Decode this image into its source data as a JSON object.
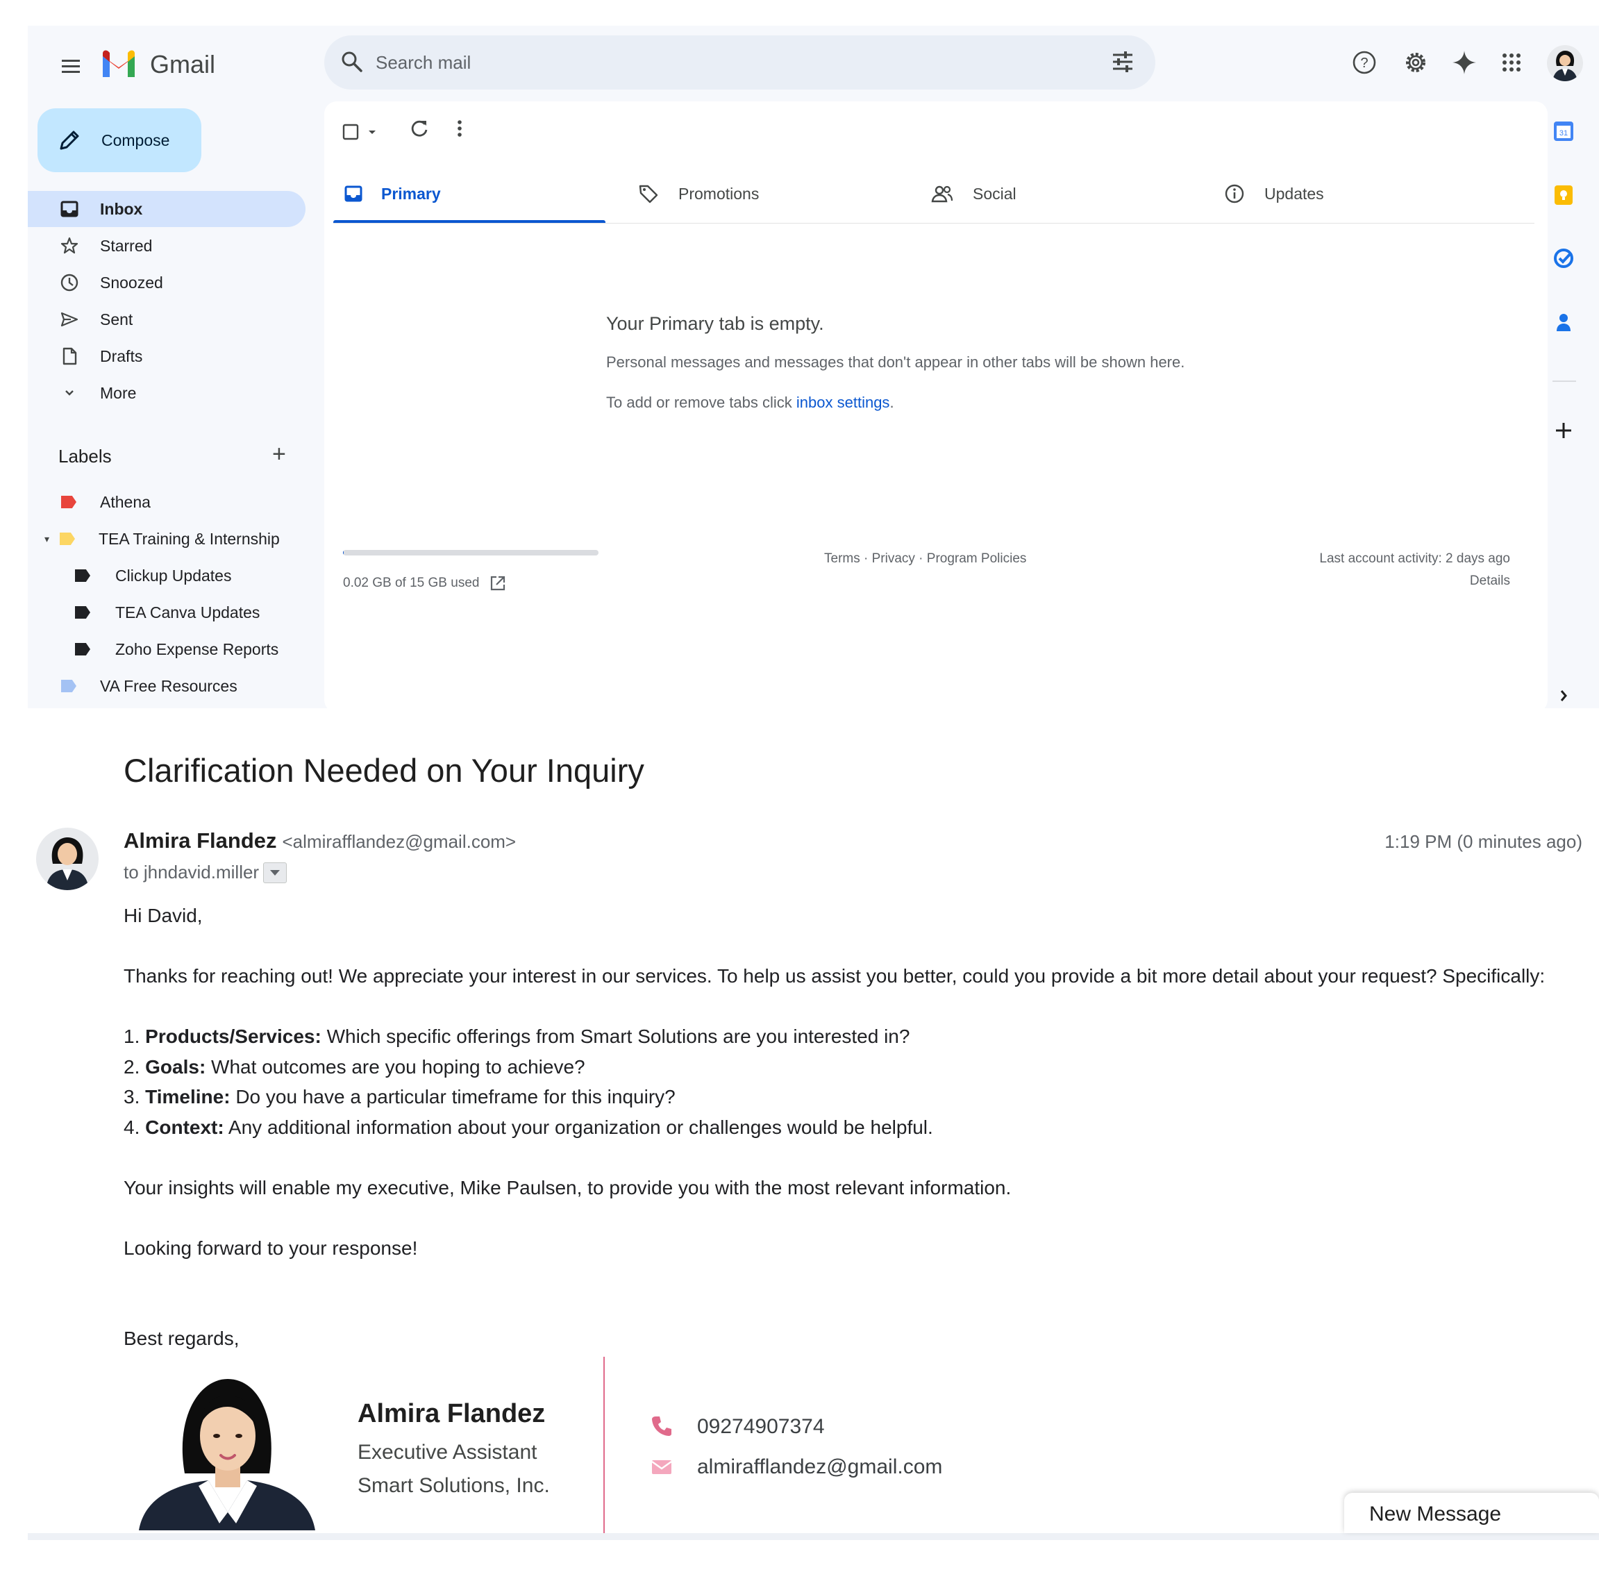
{
  "app": {
    "name": "Gmail",
    "search_placeholder": "Search mail"
  },
  "sidebar": {
    "compose_label": "Compose",
    "nav": [
      {
        "label": "Inbox",
        "icon": "inbox-icon",
        "active": true
      },
      {
        "label": "Starred",
        "icon": "star-icon"
      },
      {
        "label": "Snoozed",
        "icon": "clock-icon"
      },
      {
        "label": "Sent",
        "icon": "send-icon"
      },
      {
        "label": "Drafts",
        "icon": "draft-icon"
      },
      {
        "label": "More",
        "icon": "chevron-down-icon"
      }
    ],
    "labels_heading": "Labels",
    "labels": [
      {
        "label": "Athena",
        "color": "#e8453c"
      },
      {
        "label": "TEA Training & Internship",
        "color": "#fcd663"
      },
      {
        "label": "Clickup Updates",
        "color": "#202124"
      },
      {
        "label": "TEA Canva Updates",
        "color": "#202124"
      },
      {
        "label": "Zoho Expense Reports",
        "color": "#202124"
      },
      {
        "label": "VA Free Resources",
        "color": "#a4c2f4"
      }
    ]
  },
  "tabs": [
    {
      "label": "Primary",
      "icon": "inbox-tab-icon"
    },
    {
      "label": "Promotions",
      "icon": "tag-icon"
    },
    {
      "label": "Social",
      "icon": "people-icon"
    },
    {
      "label": "Updates",
      "icon": "info-icon"
    }
  ],
  "empty_state": {
    "title": "Your Primary tab is empty.",
    "description": "Personal messages and messages that don't appear in other tabs will be shown here.",
    "settings_prefix": "To add or remove tabs click ",
    "settings_link": "inbox settings",
    "settings_suffix": "."
  },
  "footer": {
    "storage_text": "0.02 GB of 15 GB used",
    "storage_fraction": 0.0013,
    "links": "Terms · Privacy · Program Policies",
    "last_activity": "Last account activity: 2 days ago",
    "details": "Details"
  },
  "email": {
    "subject": "Clarification Needed on Your Inquiry",
    "sender_name": "Almira Flandez",
    "sender_email": "<almirafflandez@gmail.com>",
    "recipient": "to jhndavid.miller",
    "time": "1:19 PM (0 minutes ago)",
    "greeting": "Hi David,",
    "intro": "Thanks for reaching out! We appreciate your interest in our services. To help us assist you better, could you provide a bit more detail about your request? Specifically:",
    "items": [
      {
        "num": "1. ",
        "bold": "Products/Services:",
        "text": " Which specific offerings from Smart Solutions are you interested in?"
      },
      {
        "num": "2. ",
        "bold": "Goals:",
        "text": " What outcomes are you hoping to achieve?"
      },
      {
        "num": "3. ",
        "bold": "Timeline:",
        "text": " Do you have a particular timeframe for this inquiry?"
      },
      {
        "num": "4. ",
        "bold": "Context:",
        "text": " Any additional information about your organization or challenges would be helpful."
      }
    ],
    "insights": "Your insights will enable my executive, Mike Paulsen, to provide you with the most relevant information.",
    "closing": "Looking forward to your response!",
    "regards": "Best regards,"
  },
  "signature": {
    "name": "Almira Flandez",
    "role": "Executive Assistant",
    "company": "Smart Solutions, Inc.",
    "phone": "09274907374",
    "email": "almirafflandez@gmail.com",
    "accent_color": "#e06a8b"
  },
  "new_message": {
    "label": "New Message"
  },
  "colors": {
    "accent": "#0b57d0",
    "compose": "#c2e7ff",
    "active_nav": "#d3e3fd"
  }
}
